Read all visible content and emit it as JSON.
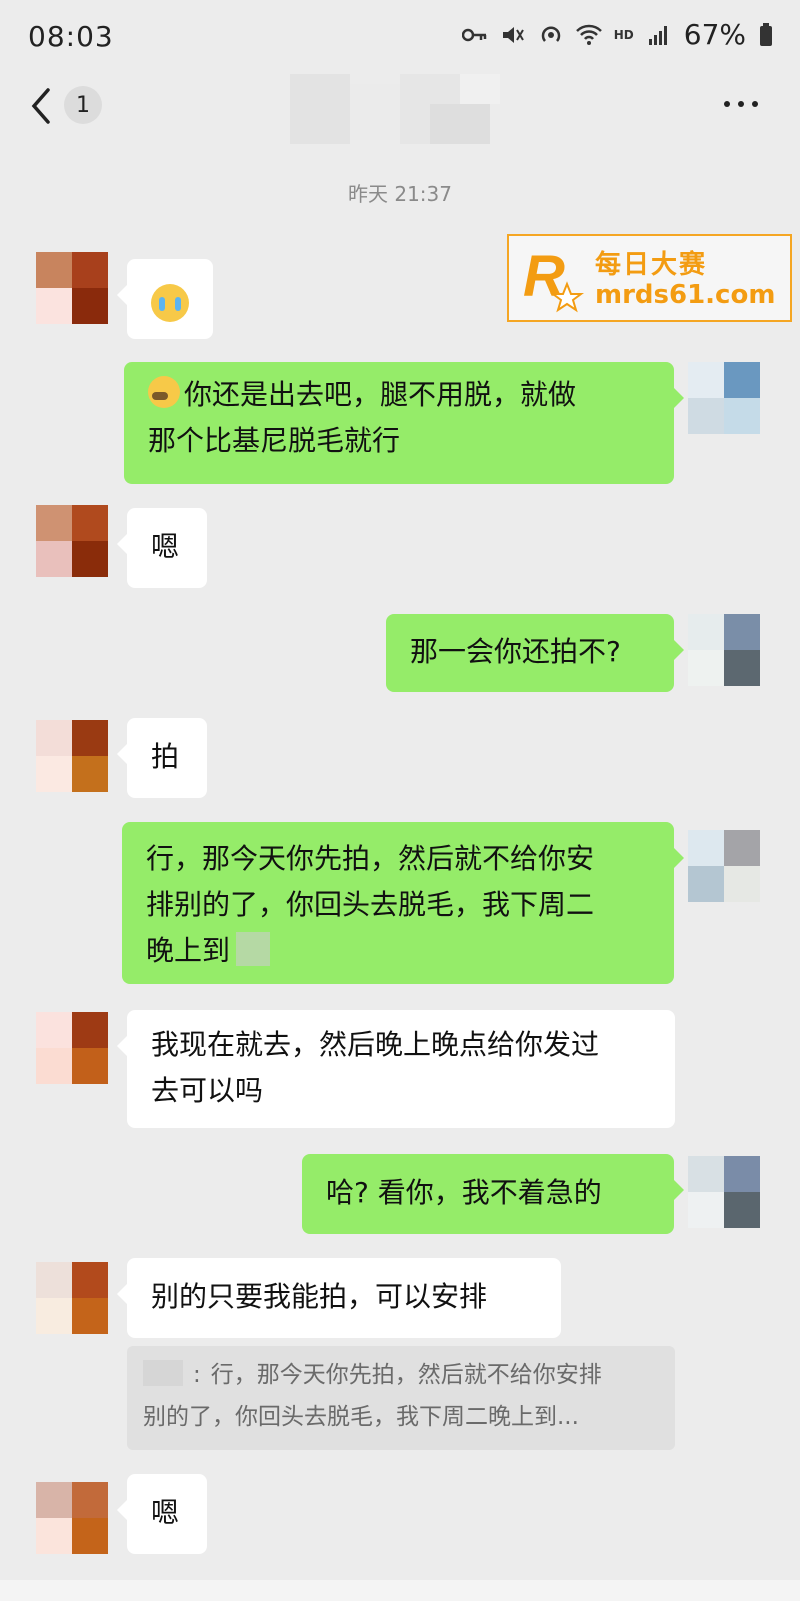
{
  "status_bar": {
    "time": "08:03",
    "network": "HD",
    "battery": "67%"
  },
  "nav": {
    "unread_count": "1"
  },
  "timestamp": "昨天 21:37",
  "watermark": {
    "brand": "每日大赛",
    "url": "mrds61.com",
    "logo_letter": "R"
  },
  "messages": [
    {
      "side": "in",
      "emoji": "loudly-crying-face"
    },
    {
      "side": "out",
      "text": "你还是出去吧，腿不用脱，就做那个比基尼脱毛就行",
      "line1": "你还是出去吧，腿不用脱，就做",
      "line2": "那个比基尼脱毛就行"
    },
    {
      "side": "in",
      "text": "嗯"
    },
    {
      "side": "out",
      "text": "那一会你还拍不?"
    },
    {
      "side": "in",
      "text": "拍"
    },
    {
      "side": "out",
      "line1": "行，那今天你先拍，然后就不给你安",
      "line2": "排别的了，你回头去脱毛，我下周二",
      "line3": "晚上到"
    },
    {
      "side": "in",
      "line1": "我现在就去，然后晚上晚点给你发过",
      "line2": "去可以吗"
    },
    {
      "side": "out",
      "text": "哈? 看你，我不着急的"
    },
    {
      "side": "in",
      "text": "别的只要我能拍，可以安排"
    },
    {
      "side": "in",
      "text": "嗯"
    }
  ],
  "quote": {
    "separator": ":",
    "line1": "行，那今天你先拍，然后就不给你安排",
    "line2": "别的了，你回头去脱毛，我下周二晚上到..."
  }
}
